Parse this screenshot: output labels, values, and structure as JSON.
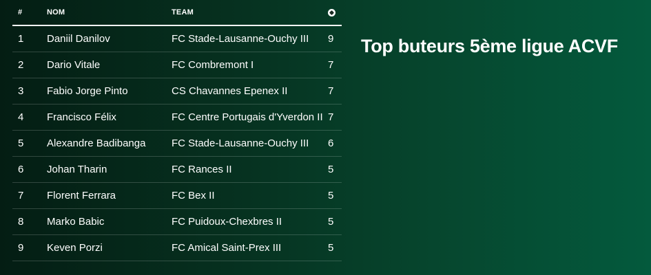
{
  "title": "Top buteurs 5ème ligue ACVF",
  "table": {
    "headers": {
      "rank": "#",
      "name": "NOM",
      "team": "TEAM",
      "goals_icon": "soccer-ball-icon"
    },
    "rows": [
      {
        "rank": "1",
        "name": "Daniil Danilov",
        "team": "FC Stade-Lausanne-Ouchy III",
        "goals": "9"
      },
      {
        "rank": "2",
        "name": "Dario Vitale",
        "team": "FC Combremont I",
        "goals": "7"
      },
      {
        "rank": "3",
        "name": "Fabio Jorge Pinto",
        "team": "CS Chavannes Epenex II",
        "goals": "7"
      },
      {
        "rank": "4",
        "name": "Francisco Félix",
        "team": "FC Centre Portugais d'Yverdon II",
        "goals": "7"
      },
      {
        "rank": "5",
        "name": "Alexandre Badibanga",
        "team": "FC Stade-Lausanne-Ouchy III",
        "goals": "6"
      },
      {
        "rank": "6",
        "name": "Johan Tharin",
        "team": "FC Rances II",
        "goals": "5"
      },
      {
        "rank": "7",
        "name": "Florent Ferrara",
        "team": "FC Bex II",
        "goals": "5"
      },
      {
        "rank": "8",
        "name": "Marko Babic",
        "team": "FC Puidoux-Chexbres II",
        "goals": "5"
      },
      {
        "rank": "9",
        "name": "Keven Porzi",
        "team": "FC Amical Saint-Prex III",
        "goals": "5"
      }
    ]
  }
}
